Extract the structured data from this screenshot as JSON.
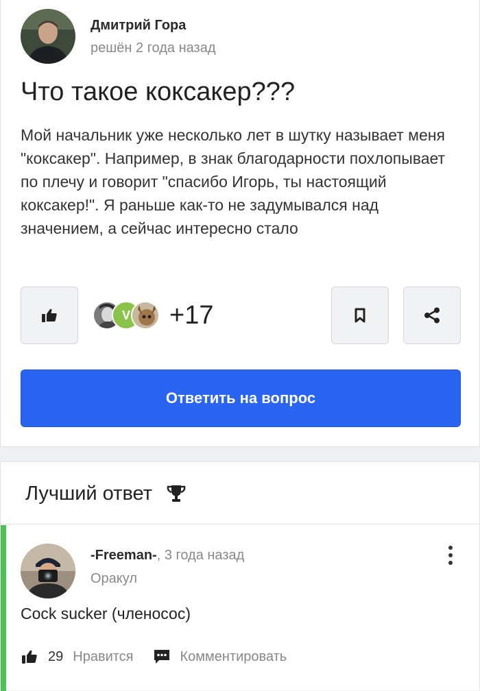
{
  "question": {
    "author": {
      "name": "Дмитрий Гора",
      "status_time": "решён 2 года назад"
    },
    "title": "Что такое коксакер???",
    "body": "Мой начальник уже несколько лет в шутку называет меня \"коксакер\". Например, в знак благодарности похлопывает по плечу и говорит \"спасибо Игорь, ты настоящий коксакер!\". Я раньше как-то не задумывался над значением, а сейчас интересно стало",
    "likers_extra": "+17",
    "liker_initial": "V",
    "answer_button_label": "Ответить на вопрос"
  },
  "best_answer": {
    "heading": "Лучший ответ",
    "author_name": "-Freeman-",
    "time": ", 3 года назад",
    "rank": "Оракул",
    "text": "Cock sucker (членосос)",
    "likes": "29",
    "like_label": "Нравится",
    "comment_label": "Комментировать"
  },
  "colors": {
    "primary": "#2965f0",
    "best_accent": "#4fc15c",
    "muted": "#888888"
  },
  "icons": [
    "thumbs-up-icon",
    "bookmark-icon",
    "share-icon",
    "trophy-icon",
    "kebab-menu-icon",
    "comment-icon"
  ]
}
